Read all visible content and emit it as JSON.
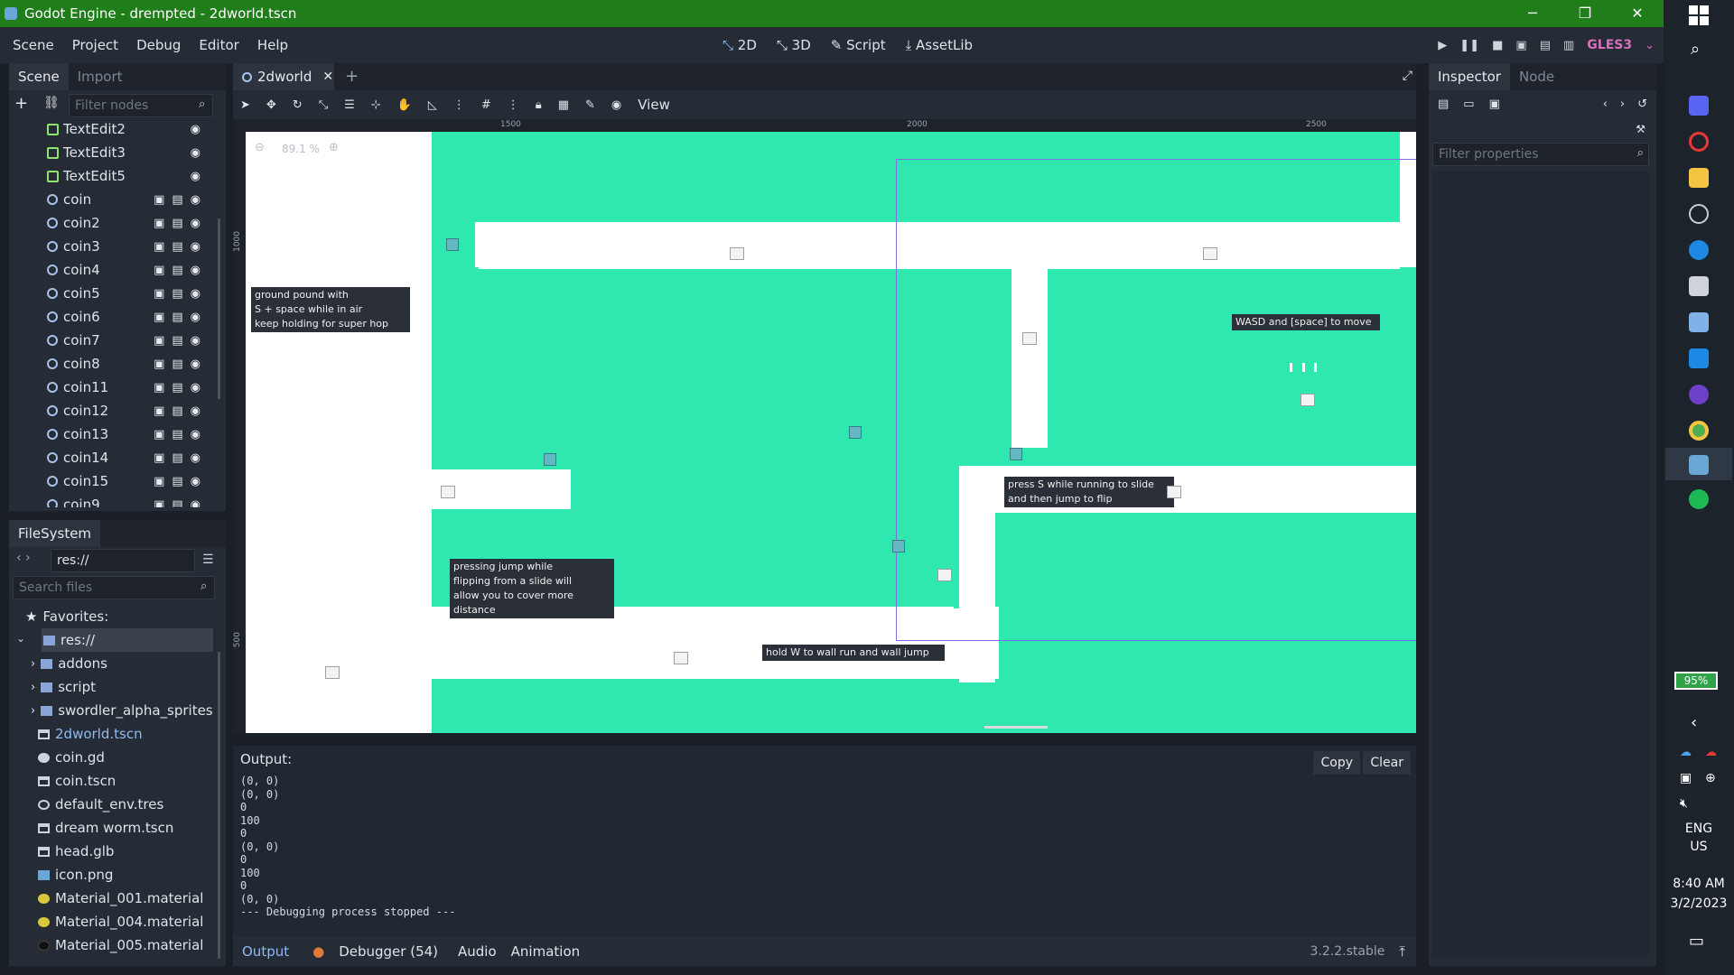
{
  "window": {
    "title": "Godot Engine - drempted - 2dworld.tscn",
    "min": "─",
    "max": "❐",
    "close": "✕"
  },
  "menu": {
    "items": [
      "Scene",
      "Project",
      "Debug",
      "Editor",
      "Help"
    ]
  },
  "workspaces": [
    {
      "label": "2D",
      "active": true
    },
    {
      "label": "3D"
    },
    {
      "label": "Script"
    },
    {
      "label": "AssetLib"
    }
  ],
  "renderer": "GLES3",
  "scene_dock": {
    "tabs": [
      "Scene",
      "Import"
    ],
    "filter_placeholder": "Filter nodes",
    "nodes": [
      {
        "name": "TextEdit2",
        "type": "control"
      },
      {
        "name": "TextEdit3",
        "type": "control"
      },
      {
        "name": "TextEdit5",
        "type": "control"
      },
      {
        "name": "coin",
        "type": "node2d"
      },
      {
        "name": "coin2",
        "type": "node2d"
      },
      {
        "name": "coin3",
        "type": "node2d"
      },
      {
        "name": "coin4",
        "type": "node2d"
      },
      {
        "name": "coin5",
        "type": "node2d"
      },
      {
        "name": "coin6",
        "type": "node2d"
      },
      {
        "name": "coin7",
        "type": "node2d"
      },
      {
        "name": "coin8",
        "type": "node2d"
      },
      {
        "name": "coin11",
        "type": "node2d"
      },
      {
        "name": "coin12",
        "type": "node2d"
      },
      {
        "name": "coin13",
        "type": "node2d"
      },
      {
        "name": "coin14",
        "type": "node2d"
      },
      {
        "name": "coin15",
        "type": "node2d"
      },
      {
        "name": "coin9",
        "type": "node2d"
      }
    ]
  },
  "filesystem": {
    "title": "FileSystem",
    "path": "res://",
    "search_placeholder": "Search files",
    "favorites": "Favorites:",
    "root": "res://",
    "folders": [
      "addons",
      "script",
      "swordler_alpha_sprites"
    ],
    "files": [
      {
        "name": "2dworld.tscn",
        "icon": "scene-icon",
        "active": true
      },
      {
        "name": "coin.gd",
        "icon": "gear-icon"
      },
      {
        "name": "coin.tscn",
        "icon": "scene-icon"
      },
      {
        "name": "default_env.tres",
        "icon": "globe-icon"
      },
      {
        "name": "dream worm.tscn",
        "icon": "scene-icon"
      },
      {
        "name": "head.glb",
        "icon": "scene-icon"
      },
      {
        "name": "icon.png",
        "icon": "image-icon"
      },
      {
        "name": "Material_001.material",
        "icon": "material-icon"
      },
      {
        "name": "Material_004.material",
        "icon": "material-icon"
      },
      {
        "name": "Material_005.material",
        "icon": "material-dark-icon"
      }
    ]
  },
  "editor_tab": {
    "label": "2dworld"
  },
  "toolbar": {
    "view_label": "View",
    "zoom": "89.1 %"
  },
  "ruler": {
    "top": [
      "1500",
      "2000",
      "2500"
    ],
    "left": [
      "1000",
      "500"
    ]
  },
  "viewport_labels": [
    {
      "text": "ground pound with\nS + space while in air\nkeep holding for super hop"
    },
    {
      "text": "WASD and [space] to move"
    },
    {
      "text": "press S while running to slide\nand then jump to flip"
    },
    {
      "text": "pressing jump while\nflipping from a slide will\nallow you to cover more\ndistance"
    },
    {
      "text": "hold W to wall run and wall jump"
    }
  ],
  "output": {
    "title": "Output:",
    "copy": "Copy",
    "clear": "Clear",
    "lines": [
      "(0, 0)",
      "(0, 0)",
      "0",
      "100",
      "0",
      "(0, 0)",
      "0",
      "100",
      "0",
      "(0, 0)",
      "--- Debugging process stopped ---"
    ]
  },
  "bottom_tabs": [
    "Output",
    "Debugger (54)",
    "Audio",
    "Animation"
  ],
  "version": "3.2.2.stable",
  "inspector": {
    "tabs": [
      "Inspector",
      "Node"
    ],
    "filter_placeholder": "Filter properties"
  },
  "taskbar": {
    "battery": "95%",
    "lang1": "ENG",
    "lang2": "US",
    "time": "8:40 AM",
    "date": "3/2/2023"
  },
  "colors": {
    "title_bar": "#1f7d1a",
    "level_green": "#2ee8b0",
    "accent": "#8fbaf5",
    "renderer": "#d86fc0"
  }
}
